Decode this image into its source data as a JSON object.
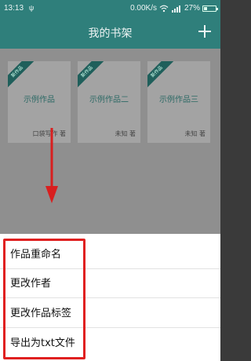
{
  "status_bar": {
    "time": "13:13",
    "usb_symbol": "ψ",
    "speed": "0.00K/s",
    "battery_percent": "27%",
    "battery_level": 0.27,
    "wifi_icon": "wifi-icon",
    "signal_icon": "signal-icon"
  },
  "app_bar": {
    "title": "我的书架",
    "add_icon": "plus-icon"
  },
  "books": [
    {
      "badge": "新作品",
      "title": "示例作品",
      "author": "口袋写作 著"
    },
    {
      "badge": "新作品",
      "title": "示例作品二",
      "author": "未知 著"
    },
    {
      "badge": "新作品",
      "title": "示例作品三",
      "author": "未知 著"
    }
  ],
  "menu": {
    "items": [
      {
        "label": "作品重命名"
      },
      {
        "label": "更改作者"
      },
      {
        "label": "更改作品标签"
      },
      {
        "label": "导出为txt文件"
      }
    ]
  },
  "colors": {
    "primary": "#2f7f7b",
    "overlay_gray": "#8f8f8f",
    "highlight_red": "#e02020"
  }
}
